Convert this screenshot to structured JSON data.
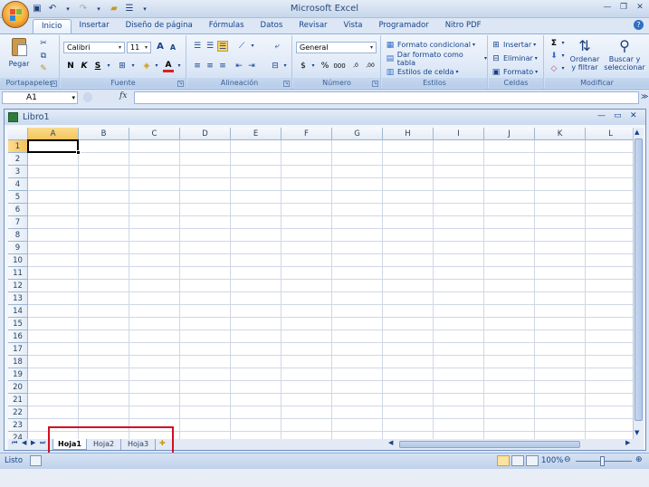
{
  "title_bar": {
    "app_title": "Microsoft Excel",
    "qat": [
      "save-icon",
      "undo-icon",
      "redo-icon",
      "open-icon",
      "customize-icon"
    ]
  },
  "tabs": [
    "Inicio",
    "Insertar",
    "Diseño de página",
    "Fórmulas",
    "Datos",
    "Revisar",
    "Vista",
    "Programador",
    "Nitro PDF"
  ],
  "active_tab": "Inicio",
  "ribbon": {
    "portapapeles": {
      "label": "Portapapeles",
      "paste": "Pegar"
    },
    "fuente": {
      "label": "Fuente",
      "font": "Calibri",
      "size": "11",
      "bold": "N",
      "italic": "K",
      "underline": "S",
      "font_color": "A",
      "grow": "A",
      "shrink": "A"
    },
    "alineacion": {
      "label": "Alineación"
    },
    "numero": {
      "label": "Número",
      "format": "General",
      "currency": "$",
      "percent": "%",
      "thousands": "000",
      "inc_dec": ",0",
      "dec_dec": ",00"
    },
    "estilos": {
      "label": "Estilos",
      "cond_format": "Formato condicional",
      "table_format": "Dar formato como tabla",
      "cell_styles": "Estilos de celda"
    },
    "celdas": {
      "label": "Celdas",
      "insert": "Insertar",
      "delete": "Eliminar",
      "format": "Formato"
    },
    "modificar": {
      "label": "Modificar",
      "sort_l1": "Ordenar",
      "sort_l2": "y filtrar",
      "find_l1": "Buscar y",
      "find_l2": "seleccionar"
    }
  },
  "formula_bar": {
    "name_box": "A1",
    "fx": "fx",
    "value": ""
  },
  "workbook": {
    "title": "Libro1",
    "columns": [
      "A",
      "B",
      "C",
      "D",
      "E",
      "F",
      "G",
      "H",
      "I",
      "J",
      "K",
      "L"
    ],
    "rows": [
      "1",
      "2",
      "3",
      "4",
      "5",
      "6",
      "7",
      "8",
      "9",
      "10",
      "11",
      "12",
      "13",
      "14",
      "15",
      "16",
      "17",
      "18",
      "19",
      "20",
      "21",
      "22",
      "23",
      "24"
    ],
    "active_cell": "A1",
    "sheets": [
      "Hoja1",
      "Hoja2",
      "Hoja3"
    ],
    "active_sheet": "Hoja1"
  },
  "status_bar": {
    "status": "Listo",
    "zoom": "100%"
  },
  "colors": {
    "highlight_box": "#d10f1e",
    "ribbon_bg": "#dfe9f7",
    "selection": "#f8c95c"
  }
}
